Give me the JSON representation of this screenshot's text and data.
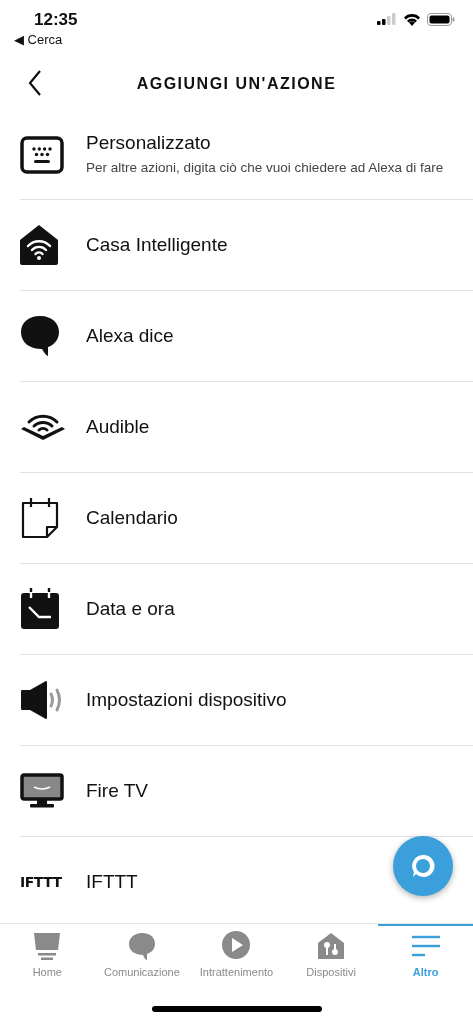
{
  "status_bar": {
    "time": "12:35",
    "back_app": "◀ Cerca"
  },
  "header": {
    "title": "AGGIUNGI UN'AZIONE"
  },
  "actions": [
    {
      "kind": "keyboard",
      "label": "Personalizzato",
      "description": "Per altre azioni, digita ciò che vuoi chiedere ad Alexa di fare"
    },
    {
      "kind": "smart-home",
      "label": "Casa Intelligente"
    },
    {
      "kind": "speech",
      "label": "Alexa dice"
    },
    {
      "kind": "audible",
      "label": "Audible"
    },
    {
      "kind": "calendar",
      "label": "Calendario"
    },
    {
      "kind": "clock-calendar",
      "label": "Data e ora"
    },
    {
      "kind": "speaker",
      "label": "Impostazioni dispositivo"
    },
    {
      "kind": "tv",
      "label": "Fire TV"
    },
    {
      "kind": "logo",
      "logo_text": "IFTTT",
      "label": "IFTTT"
    }
  ],
  "tab_bar": [
    {
      "kind": "home",
      "label": "Home",
      "selected": false
    },
    {
      "kind": "speech",
      "label": "Comunicazione",
      "selected": false
    },
    {
      "kind": "play",
      "label": "Intrattenimento",
      "selected": false
    },
    {
      "kind": "devices",
      "label": "Dispositivi",
      "selected": false
    },
    {
      "kind": "menu",
      "label": "Altro",
      "selected": true
    }
  ]
}
